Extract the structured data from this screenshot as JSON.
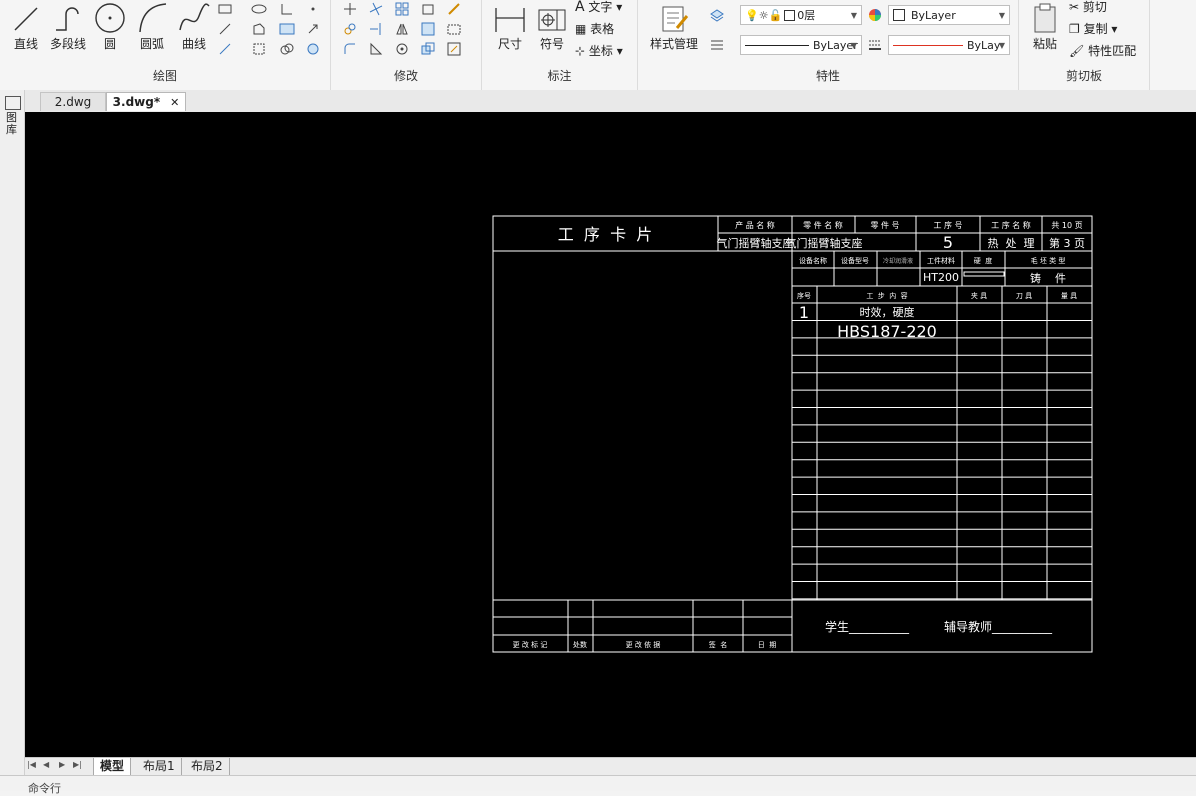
{
  "ribbon": {
    "draw": {
      "title": "绘图",
      "line": "直线",
      "polyline": "多段线",
      "circle": "圆",
      "arc": "圆弧",
      "curve": "曲线"
    },
    "modify": {
      "title": "修改"
    },
    "annotate": {
      "title": "标注",
      "dimension": "尺寸",
      "symbol": "符号",
      "text": "文字",
      "table": "表格",
      "coord": "坐标"
    },
    "style": {
      "label": "样式管理"
    },
    "properties": {
      "title": "特性",
      "layer_value": "0层",
      "color_value": "ByLayer",
      "linetype_value": "ByLayer",
      "lineweight_value": "ByLay"
    },
    "clipboard": {
      "title": "剪切板",
      "paste": "粘贴",
      "cut": "剪切",
      "copy": "复制",
      "match": "特性匹配"
    }
  },
  "tabs": [
    {
      "label": "2.dwg",
      "active": false
    },
    {
      "label": "3.dwg*",
      "active": true
    }
  ],
  "close_glyph": "✕",
  "side_label": "图库",
  "drawing": {
    "title": "工  序  卡  片",
    "header_labels": [
      "产 品 名 称",
      "零 件 名 称",
      "零 件 号",
      "工 序 号",
      "工 序 名 称",
      "共 10 页"
    ],
    "header_values": [
      "气门摇臂轴支座",
      "气门摇臂轴支座",
      "",
      "5",
      "热  处  理",
      "第 3 页"
    ],
    "row2_labels": [
      "设备名称",
      "设备型号",
      "冷却润滑液",
      "工件材料",
      "硬  度",
      "毛 坯 类 型"
    ],
    "row2_values": [
      "",
      "",
      "",
      "HT200",
      "",
      "铸    件"
    ],
    "table_headers": [
      "序号",
      "工  步  内  容",
      "夹 具",
      "刀 具",
      "量 具"
    ],
    "steps": [
      {
        "no": "1",
        "content": "时效，硬度"
      },
      {
        "no": "",
        "content": "HBS187-220"
      }
    ],
    "footer_labels": [
      "更 改 标 记",
      "处数",
      "更 改 依 据",
      "签  名",
      "日  期"
    ],
    "student": "学生__________",
    "teacher": "辅导教师__________"
  },
  "layout_tabs": [
    "模型",
    "布局1",
    "布局2"
  ],
  "nav_arrows": [
    "|◀",
    "◀",
    "▶",
    "▶|"
  ],
  "command_label": "命令行"
}
